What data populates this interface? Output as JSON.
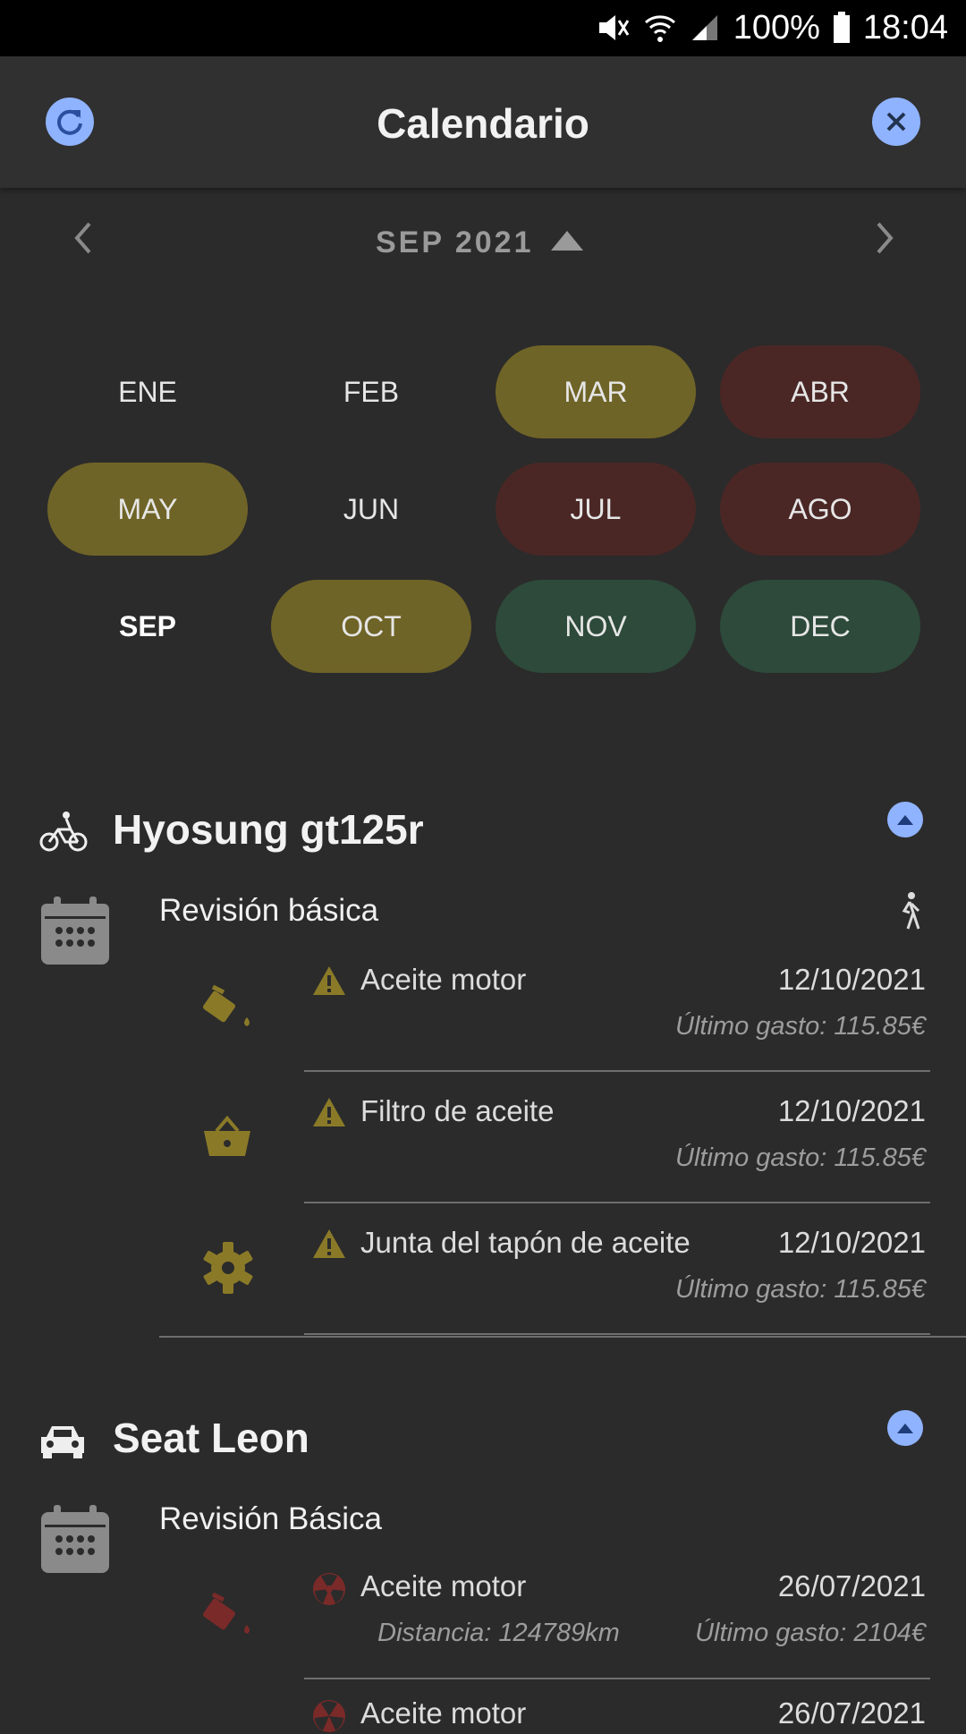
{
  "status_bar": {
    "battery": "100%",
    "time": "18:04"
  },
  "header": {
    "title": "Calendario",
    "refresh_icon": "refresh-icon",
    "close_icon": "close-icon"
  },
  "month_nav": {
    "label": "SEP 2021"
  },
  "months": [
    {
      "label": "ENE",
      "status": "none"
    },
    {
      "label": "FEB",
      "status": "none"
    },
    {
      "label": "MAR",
      "status": "warning",
      "color": "#6f6427"
    },
    {
      "label": "ABR",
      "status": "overdue",
      "color": "#4a2725"
    },
    {
      "label": "MAY",
      "status": "warning",
      "color": "#6f6427"
    },
    {
      "label": "JUN",
      "status": "none"
    },
    {
      "label": "JUL",
      "status": "overdue",
      "color": "#4a2725"
    },
    {
      "label": "AGO",
      "status": "overdue",
      "color": "#4a2725"
    },
    {
      "label": "SEP",
      "status": "current"
    },
    {
      "label": "OCT",
      "status": "warning",
      "color": "#6f6427"
    },
    {
      "label": "NOV",
      "status": "ok",
      "color": "#2d4a3a"
    },
    {
      "label": "DEC",
      "status": "ok",
      "color": "#2d4a3a"
    }
  ],
  "vehicles": [
    {
      "name": "Hyosung gt125r",
      "icon": "bicycle-icon",
      "service": "Revisión básica",
      "items": [
        {
          "name": "Aceite motor",
          "date": "12/10/2021",
          "cost": "Último gasto: 115.85€",
          "icon": "oil-can-icon",
          "status_icon": "warning-icon"
        },
        {
          "name": "Filtro de aceite",
          "date": "12/10/2021",
          "cost": "Último gasto: 115.85€",
          "icon": "basket-icon",
          "status_icon": "warning-icon"
        },
        {
          "name": "Junta del tapón de aceite",
          "date": "12/10/2021",
          "cost": "Último gasto: 115.85€",
          "icon": "gear-icon",
          "status_icon": "warning-icon"
        }
      ]
    },
    {
      "name": "Seat Leon",
      "icon": "car-icon",
      "service": "Revisión Básica",
      "items": [
        {
          "name": "Aceite motor",
          "date": "26/07/2021",
          "distance": "Distancia: 124789km",
          "cost": "Último gasto: 2104€",
          "icon": "oil-can-icon",
          "status_icon": "radiation-icon"
        },
        {
          "name": "Aceite motor",
          "date": "26/07/2021",
          "icon": "oil-can-icon",
          "status_icon": "radiation-icon"
        }
      ]
    }
  ],
  "colors": {
    "accent": "#8fb3ff",
    "warning": "#6f6427",
    "overdue": "#4a2725",
    "ok": "#2d4a3a",
    "warning_icon": "#8a7a28",
    "overdue_icon": "#7a2a28"
  }
}
